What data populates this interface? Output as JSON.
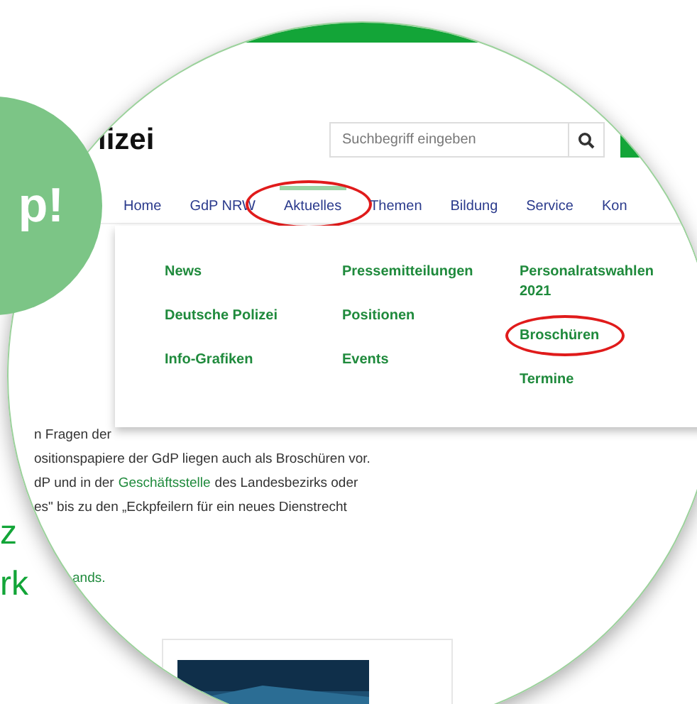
{
  "badge": {
    "text": "p!"
  },
  "side_text": [
    {
      "text": "z"
    },
    {
      "text": "rk"
    }
  ],
  "site": {
    "logo_text": "lizei",
    "search": {
      "placeholder": "Suchbegriff eingeben"
    },
    "nav": [
      {
        "label": "Home",
        "selected": false,
        "circled": false
      },
      {
        "label": "GdP NRW",
        "selected": false,
        "circled": false
      },
      {
        "label": "Aktuelles",
        "selected": true,
        "circled": true
      },
      {
        "label": "Themen",
        "selected": false,
        "circled": false
      },
      {
        "label": "Bildung",
        "selected": false,
        "circled": false
      },
      {
        "label": "Service",
        "selected": false,
        "circled": false
      },
      {
        "label": "Kon",
        "selected": false,
        "circled": false
      }
    ],
    "menu": {
      "columns": [
        {
          "items": [
            {
              "label": "News",
              "circled": false
            },
            {
              "label": "Deutsche Polizei",
              "circled": false
            },
            {
              "label": "Info-Grafiken",
              "circled": false
            }
          ]
        },
        {
          "items": [
            {
              "label": "Pressemitteilungen",
              "circled": false
            },
            {
              "label": "Positionen",
              "circled": false
            },
            {
              "label": "Events",
              "circled": false
            }
          ]
        },
        {
          "items": [
            {
              "label": "Personalratswahlen 2021",
              "circled": false
            },
            {
              "label": "Broschüren",
              "circled": true
            },
            {
              "label": "Termine",
              "circled": false
            }
          ]
        }
      ]
    }
  },
  "article": {
    "lines": [
      [
        {
          "kind": "text",
          "text": "n Fragen der"
        }
      ],
      [
        {
          "kind": "text",
          "text": "ositionspapiere der GdP liegen auch als Broschüren vor."
        }
      ],
      [
        {
          "kind": "text",
          "text": "dP und in der"
        },
        {
          "kind": "link",
          "text": "Geschäftsstelle"
        },
        {
          "kind": "text",
          "text": "des Landesbezirks oder"
        }
      ],
      [
        {
          "kind": "text",
          "text": "es\" bis zu den „Eckpfeilern für ein neues Dienstrecht"
        }
      ]
    ],
    "link_text": "ands."
  }
}
